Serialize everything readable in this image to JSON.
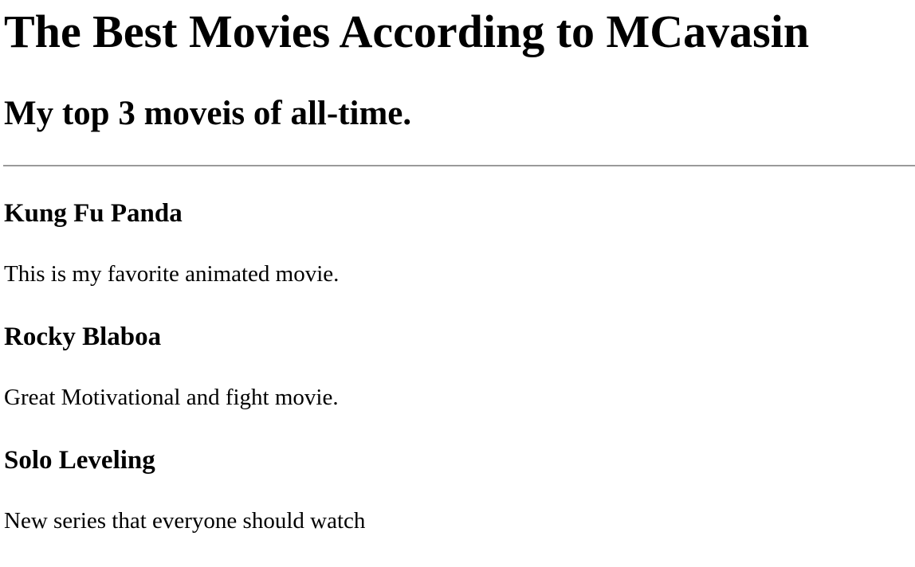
{
  "header": {
    "title": "The Best Movies According to MCavasin",
    "subtitle": "My top 3 moveis of all-time."
  },
  "movies": [
    {
      "title": "Kung Fu Panda",
      "description": "This is my favorite animated movie."
    },
    {
      "title": "Rocky Blaboa",
      "description": "Great Motivational and fight movie."
    },
    {
      "title": "Solo Leveling",
      "description": "New series that everyone should watch"
    }
  ]
}
